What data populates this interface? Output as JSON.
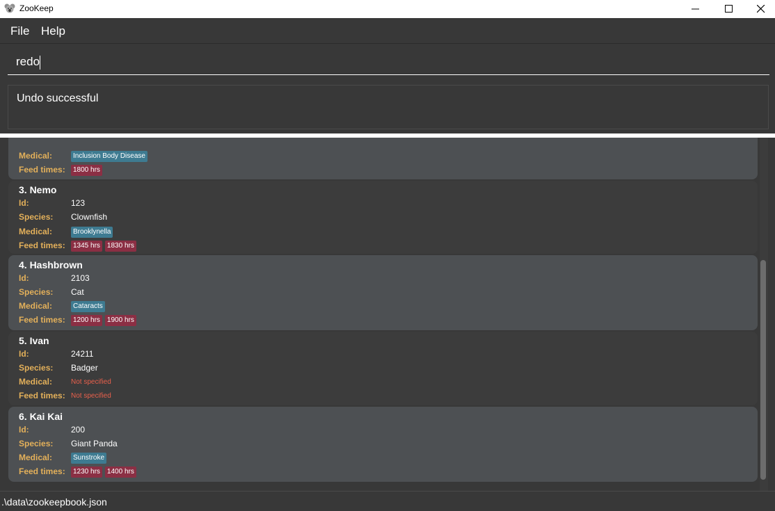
{
  "window": {
    "title": "ZooKeep"
  },
  "menu": {
    "file": "File",
    "help": "Help"
  },
  "command": {
    "value": "redo"
  },
  "result": {
    "text": "Undo successful"
  },
  "labels": {
    "id": "Id:",
    "species": "Species:",
    "medical": "Medical:",
    "feed": "Feed times:"
  },
  "not_specified": "Not specified",
  "partial_card": {
    "medical": [
      "Inclusion Body Disease"
    ],
    "feed": [
      "1800 hrs"
    ]
  },
  "animals": [
    {
      "title": "3.  Nemo",
      "id": "123",
      "species": "Clownfish",
      "medical": [
        "Brooklynella"
      ],
      "feed": [
        "1345 hrs",
        "1830 hrs"
      ]
    },
    {
      "title": "4.  Hashbrown",
      "id": "2103",
      "species": "Cat",
      "medical": [
        "Cataracts"
      ],
      "feed": [
        "1200 hrs",
        "1900 hrs"
      ]
    },
    {
      "title": "5.  Ivan",
      "id": "24211",
      "species": "Badger",
      "medical": [],
      "feed": []
    },
    {
      "title": "6.  Kai Kai",
      "id": "200",
      "species": "Giant Panda",
      "medical": [
        "Sunstroke"
      ],
      "feed": [
        "1230 hrs",
        "1400 hrs"
      ]
    }
  ],
  "status": {
    "path": ".\\data\\zookeepbook.json"
  },
  "colors": {
    "label": "#e3b05a",
    "medical_tag": "#3e7b91",
    "feed_tag": "#8b2f44",
    "not_specified": "#e8604c"
  },
  "icons": {
    "app": "koala-icon",
    "minimize": "minimize-icon",
    "maximize": "maximize-icon",
    "close": "close-icon"
  }
}
